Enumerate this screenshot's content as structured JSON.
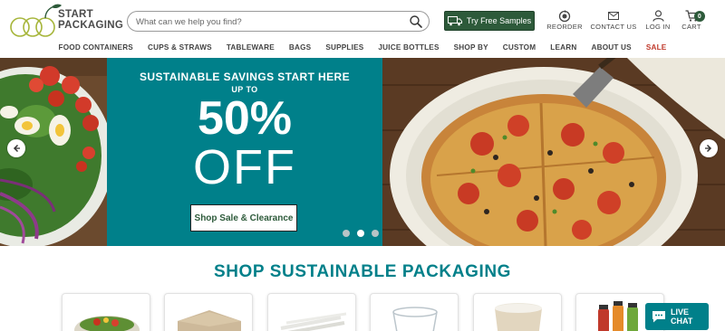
{
  "brand": {
    "name_line1": "START",
    "name_line2": "PACKAGING",
    "accent_color": "#00808a",
    "dark_green": "#2d5a3a",
    "sale_color": "#c0392b"
  },
  "search": {
    "placeholder": "What can we help you find?",
    "value": ""
  },
  "header": {
    "samples_label": "Try Free Samples",
    "reorder_label": "REORDER",
    "contact_label": "CONTACT US",
    "login_label": "LOG IN",
    "cart_label": "CART",
    "cart_count": "0"
  },
  "nav": {
    "items": [
      {
        "label": "FOOD CONTAINERS"
      },
      {
        "label": "CUPS & STRAWS"
      },
      {
        "label": "TABLEWARE"
      },
      {
        "label": "BAGS"
      },
      {
        "label": "SUPPLIES"
      },
      {
        "label": "JUICE BOTTLES"
      },
      {
        "label": "SHOP BY"
      },
      {
        "label": "CUSTOM"
      },
      {
        "label": "LEARN"
      },
      {
        "label": "ABOUT US"
      },
      {
        "label": "SALE"
      }
    ]
  },
  "hero": {
    "headline": "SUSTAINABLE SAVINGS START HERE",
    "subline": "UP TO",
    "percent": "50%",
    "off": "OFF",
    "button_label": "Shop Sale & Clearance",
    "slides_total": 3,
    "active_slide": 2
  },
  "section": {
    "title": "SHOP SUSTAINABLE PACKAGING"
  },
  "chat": {
    "line1": "LIVE",
    "line2": "CHAT"
  },
  "icons": [
    "search-icon",
    "truck-icon",
    "reorder-icon",
    "mail-icon",
    "user-icon",
    "cart-icon",
    "chevron-left-icon",
    "chevron-right-icon",
    "chat-icon"
  ]
}
